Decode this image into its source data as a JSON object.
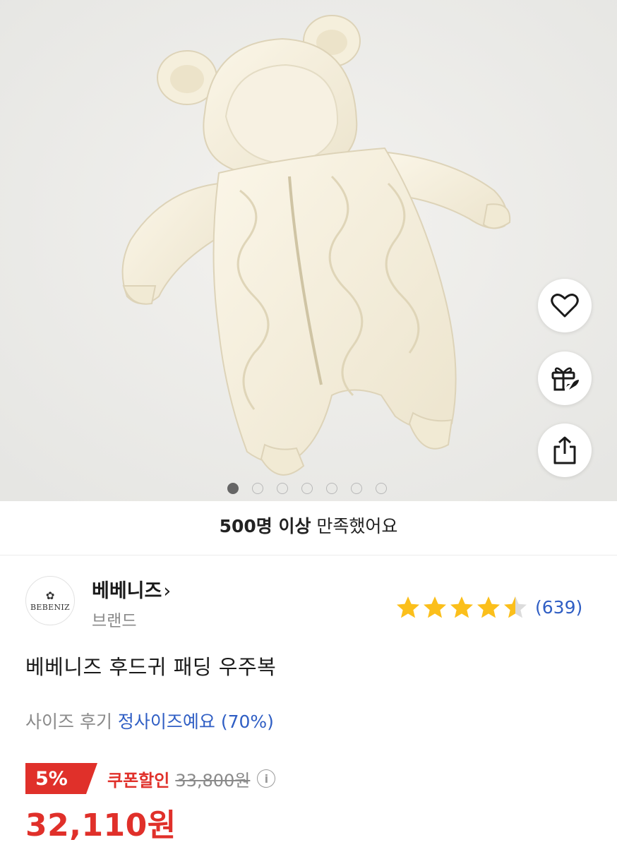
{
  "gallery": {
    "slide_count": 7,
    "active_slide": 0
  },
  "actions": {
    "wishlist_icon": "heart-icon",
    "gift_icon": "gift-icon",
    "share_icon": "share-icon"
  },
  "satisfaction": {
    "bold": "500명 이상",
    "rest": " 만족했어요"
  },
  "brand": {
    "logo_text": "BEBENIZ",
    "name": "베베니즈",
    "chevron": "›",
    "type": "브랜드"
  },
  "rating": {
    "value": 4.5,
    "max": 5,
    "count_text": "(639)",
    "star_color": "#FBBF1B"
  },
  "product": {
    "title": "베베니즈 후드귀 패딩 우주복"
  },
  "size_review": {
    "label": "사이즈 후기 ",
    "value": "정사이즈예요 (70%)"
  },
  "pricing": {
    "discount_badge": "5%",
    "coupon_label": "쿠폰할인",
    "original_price": "33,800원",
    "info_icon": "i",
    "final_price": "32,110원",
    "accent_color": "#E0302A"
  }
}
